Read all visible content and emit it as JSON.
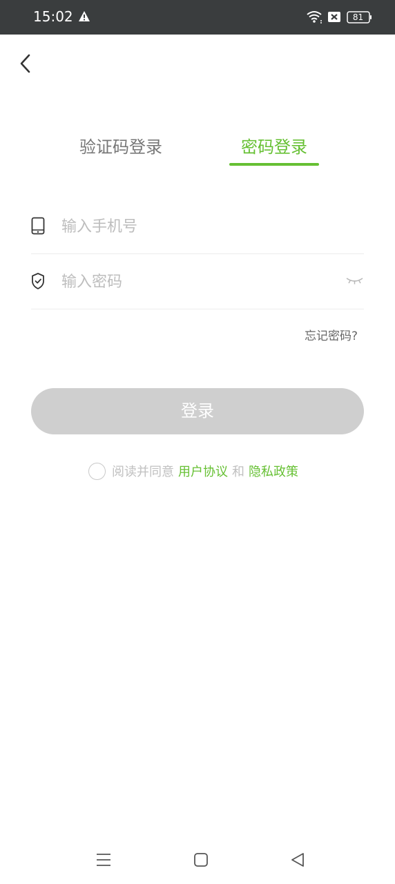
{
  "status_bar": {
    "time": "15:02",
    "battery": "81",
    "icons": [
      "warning-icon",
      "wifi-icon",
      "notification-blocked-icon",
      "battery-icon"
    ]
  },
  "header": {
    "back_icon": "chevron-left-icon"
  },
  "tabs": [
    {
      "label": "验证码登录",
      "active": false
    },
    {
      "label": "密码登录",
      "active": true
    }
  ],
  "form": {
    "phone": {
      "placeholder": "输入手机号",
      "value": "",
      "icon": "phone-icon"
    },
    "password": {
      "placeholder": "输入密码",
      "value": "",
      "icon": "shield-check-icon",
      "toggle_icon": "eye-closed-icon"
    },
    "forgot_label": "忘记密码?"
  },
  "login_button": {
    "label": "登录",
    "enabled": false
  },
  "agreement": {
    "prefix": "阅读并同意",
    "user_agreement": "用户协议",
    "conjunction": "和",
    "privacy_policy": "隐私政策",
    "checked": false
  },
  "colors": {
    "accent": "#66c033",
    "status_bar": "#3a3d3e",
    "button_disabled": "#cfcfcf"
  },
  "nav_bar": {
    "icons": [
      "menu-icon",
      "home-square-icon",
      "back-triangle-icon"
    ]
  }
}
